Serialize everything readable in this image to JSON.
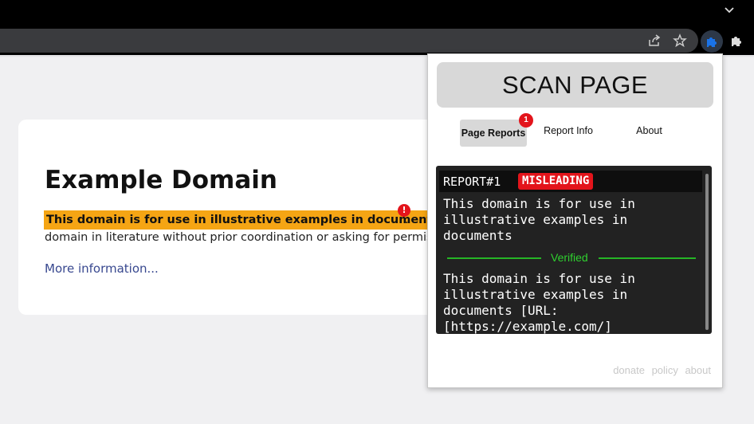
{
  "browser": {
    "icons": {
      "tab_menu": "chevron-down-icon",
      "share": "share-icon",
      "bookmark": "star-icon",
      "active_extension": "puzzle-icon",
      "extensions": "puzzle-icon"
    },
    "colors": {
      "active_extension": "#1a73e8"
    }
  },
  "page": {
    "title": "Example Domain",
    "highlighted_text": "This domain is for use in illustrative examples in documents",
    "trailing_period": ".",
    "highlight_badge": "!",
    "paragraph2": "domain in literature without prior coordination or asking for permission.",
    "more_link": "More information...",
    "colors": {
      "highlight": "#f5a514",
      "link": "#38488f"
    }
  },
  "popup": {
    "scan_button": "SCAN PAGE",
    "tabs": [
      {
        "label": "Page Reports",
        "badge": "1",
        "active": true
      },
      {
        "label": "Report Info"
      },
      {
        "label": "About"
      }
    ],
    "report": {
      "id": "REPORT#1",
      "tag": "MISLEADING",
      "claim": "This domain is for use in illustrative examples in documents",
      "divider_label": "Verified",
      "verified": "This domain is for use in illustrative examples in documents [URL: [https://example.com/]"
    },
    "footer_links": [
      "donate",
      "policy",
      "about"
    ],
    "colors": {
      "tag": "#e3141b",
      "verified": "#2fd02f",
      "badge": "#e3141b"
    }
  }
}
